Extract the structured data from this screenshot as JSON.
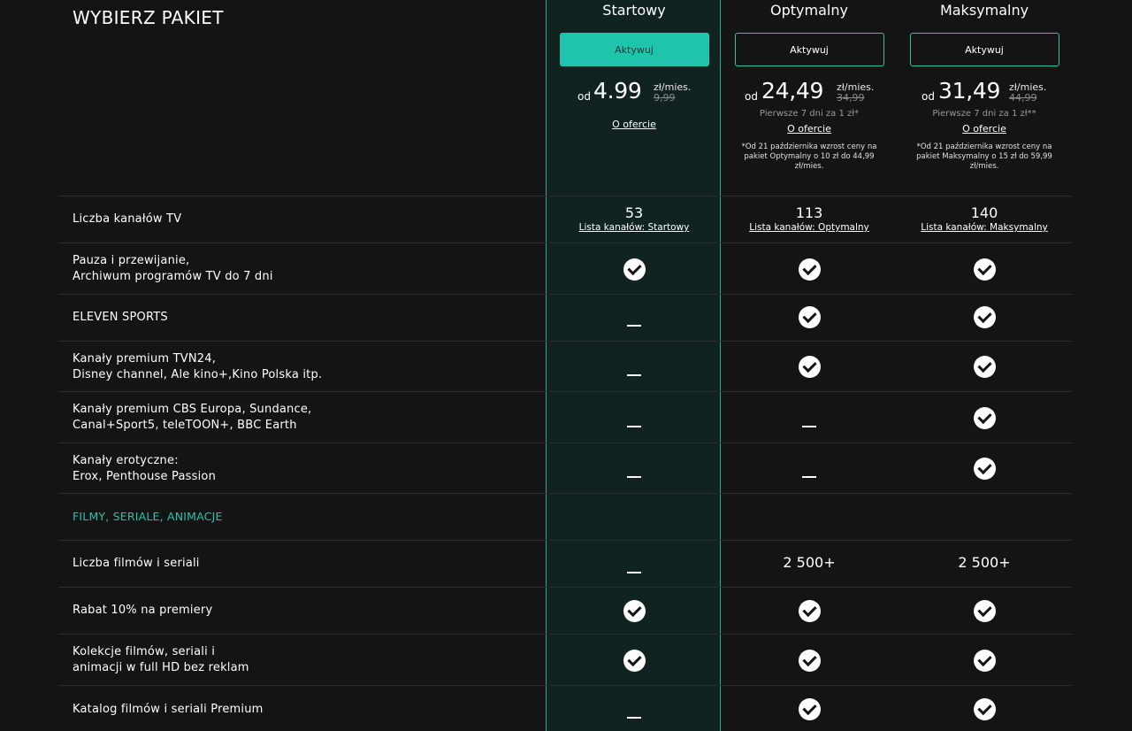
{
  "header": {
    "title": "WYBIERZ PAKIET"
  },
  "plans": [
    {
      "name": "Startowy",
      "button": "Aktywuj",
      "od": "od",
      "price": "4.99",
      "unit": "zł/mies.",
      "old_price": "9,99",
      "promo": "",
      "offer_link": "O ofercie",
      "note": "",
      "channels_count": "53",
      "channels_link": "Lista kanałów: Startowy"
    },
    {
      "name": "Optymalny",
      "button": "Aktywuj",
      "od": "od",
      "price": "24,49",
      "unit": "zł/mies.",
      "old_price": "34,99",
      "promo": "Pierwsze 7 dni za 1 zł*",
      "offer_link": "O ofercie",
      "note": "*Od 21 października wzrost ceny na pakiet Optymalny o 10 zł do 44,99 zł/mies.",
      "channels_count": "113",
      "channels_link": "Lista kanałów: Optymalny"
    },
    {
      "name": "Maksymalny",
      "button": "Aktywuj",
      "od": "od",
      "price": "31,49",
      "unit": "zł/mies.",
      "old_price": "44,99",
      "promo": "Pierwsze 7 dni za 1 zł**",
      "offer_link": "O ofercie",
      "note": "*Od 21 października wzrost ceny na pakiet Maksymalny o 15 zł do 59,99 zł/mies.",
      "channels_count": "140",
      "channels_link": "Lista kanałów: Maksymalny"
    }
  ],
  "rows": {
    "channels_label": "Liczba kanałów TV",
    "pause": {
      "line1": "Pauza i przewijanie,",
      "line2": "Archiwum programów TV do 7 dni"
    },
    "eleven": {
      "line1": "ELEVEN SPORTS"
    },
    "premium1": {
      "line1": "Kanały premium TVN24,",
      "line2": "Disney channel, Ale kino+,Kino Polska itp."
    },
    "premium2": {
      "line1": "Kanały premium CBS Europa, Sundance,",
      "line2": "Canal+Sport5, teleTOON+, BBC Earth"
    },
    "erotic": {
      "line1": "Kanały erotyczne:",
      "line2": "Erox, Penthouse Passion"
    },
    "section": "FILMY, SERIALE, ANIMACJE",
    "movies_count": {
      "line1": "Liczba filmów i seriali",
      "values": [
        "",
        "2 500+",
        "2 500+"
      ]
    },
    "discount": {
      "line1": "Rabat 10% na premiery"
    },
    "collections": {
      "line1": "Kolekcje filmów, seriali i",
      "line2": "animacji w full HD bez reklam"
    },
    "catalog": {
      "line1": "Katalog filmów i seriali Premium"
    }
  },
  "colors": {
    "accent": "#20c4ac",
    "background": "#141414",
    "highlight_column": "#112321"
  }
}
